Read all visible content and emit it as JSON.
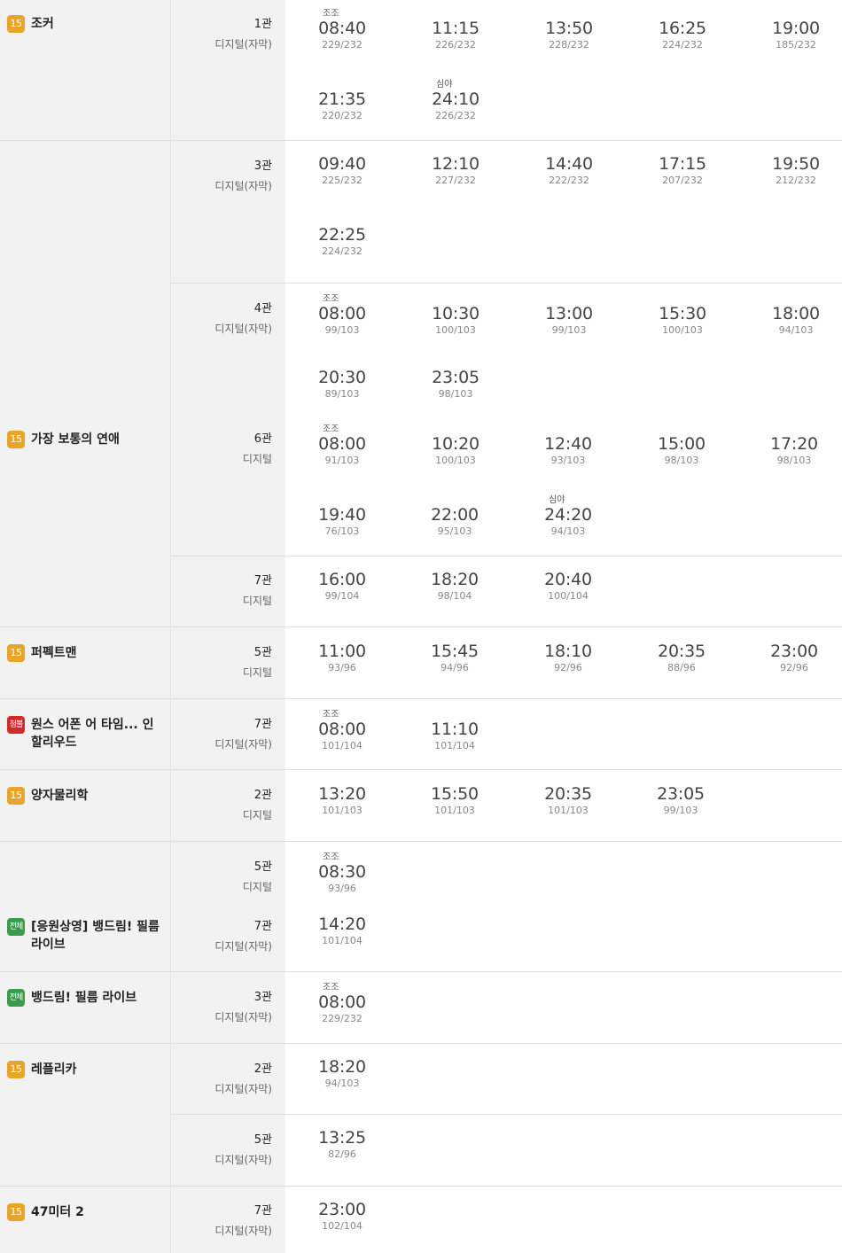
{
  "movies": [
    {
      "title": "조커",
      "rating": "15",
      "rating_class": "age15"
    },
    {
      "title": "가장 보통의 연애",
      "rating": "15",
      "rating_class": "age15"
    },
    {
      "title": "퍼펙트맨",
      "rating": "15",
      "rating_class": "age15"
    },
    {
      "title": "원스 어폰 어 타임... 인 할리우드",
      "rating": "청불",
      "rating_class": "adult"
    },
    {
      "title": "양자물리학",
      "rating": "15",
      "rating_class": "age15"
    },
    {
      "title": "[응원상영] 뱅드림! 필름 라이브",
      "rating": "전체",
      "rating_class": "all"
    },
    {
      "title": "뱅드림! 필름 라이브",
      "rating": "전체",
      "rating_class": "all"
    },
    {
      "title": "레플리카",
      "rating": "15",
      "rating_class": "age15"
    },
    {
      "title": "47미터 2",
      "rating": "15",
      "rating_class": "age15"
    }
  ],
  "halls": [
    {
      "name": "1관",
      "format": "디지털(자막)"
    },
    {
      "name": "3관",
      "format": "디지털(자막)"
    },
    {
      "name": "4관",
      "format": "디지털(자막)"
    },
    {
      "name": "6관",
      "format": "디지털"
    },
    {
      "name": "7관",
      "format": "디지털"
    },
    {
      "name": "5관",
      "format": "디지털"
    },
    {
      "name": "7관",
      "format": "디지털(자막)"
    },
    {
      "name": "2관",
      "format": "디지털"
    },
    {
      "name": "5관",
      "format": "디지털"
    },
    {
      "name": "7관",
      "format": "디지털(자막)"
    },
    {
      "name": "3관",
      "format": "디지털(자막)"
    },
    {
      "name": "2관",
      "format": "디지털(자막)"
    },
    {
      "name": "5관",
      "format": "디지털(자막)"
    },
    {
      "name": "7관",
      "format": "디지털(자막)"
    }
  ],
  "slots": [
    {
      "tag": "조조",
      "time": "08:40",
      "seats": "229/232"
    },
    {
      "tag": "",
      "time": "11:15",
      "seats": "226/232"
    },
    {
      "tag": "",
      "time": "13:50",
      "seats": "228/232"
    },
    {
      "tag": "",
      "time": "16:25",
      "seats": "224/232"
    },
    {
      "tag": "",
      "time": "19:00",
      "seats": "185/232"
    },
    {
      "tag": "",
      "time": "21:35",
      "seats": "220/232"
    },
    {
      "tag": "심야",
      "time": "24:10",
      "seats": "226/232"
    },
    {
      "tag": "",
      "time": "09:40",
      "seats": "225/232"
    },
    {
      "tag": "",
      "time": "12:10",
      "seats": "227/232"
    },
    {
      "tag": "",
      "time": "14:40",
      "seats": "222/232"
    },
    {
      "tag": "",
      "time": "17:15",
      "seats": "207/232"
    },
    {
      "tag": "",
      "time": "19:50",
      "seats": "212/232"
    },
    {
      "tag": "",
      "time": "22:25",
      "seats": "224/232"
    },
    {
      "tag": "조조",
      "time": "08:00",
      "seats": "99/103"
    },
    {
      "tag": "",
      "time": "10:30",
      "seats": "100/103"
    },
    {
      "tag": "",
      "time": "13:00",
      "seats": "99/103"
    },
    {
      "tag": "",
      "time": "15:30",
      "seats": "100/103"
    },
    {
      "tag": "",
      "time": "18:00",
      "seats": "94/103"
    },
    {
      "tag": "",
      "time": "20:30",
      "seats": "89/103"
    },
    {
      "tag": "",
      "time": "23:05",
      "seats": "98/103"
    },
    {
      "tag": "조조",
      "time": "08:00",
      "seats": "91/103"
    },
    {
      "tag": "",
      "time": "10:20",
      "seats": "100/103"
    },
    {
      "tag": "",
      "time": "12:40",
      "seats": "93/103"
    },
    {
      "tag": "",
      "time": "15:00",
      "seats": "98/103"
    },
    {
      "tag": "",
      "time": "17:20",
      "seats": "98/103"
    },
    {
      "tag": "",
      "time": "19:40",
      "seats": "76/103"
    },
    {
      "tag": "",
      "time": "22:00",
      "seats": "95/103"
    },
    {
      "tag": "심야",
      "time": "24:20",
      "seats": "94/103"
    },
    {
      "tag": "",
      "time": "16:00",
      "seats": "99/104"
    },
    {
      "tag": "",
      "time": "18:20",
      "seats": "98/104"
    },
    {
      "tag": "",
      "time": "20:40",
      "seats": "100/104"
    },
    {
      "tag": "",
      "time": "11:00",
      "seats": "93/96"
    },
    {
      "tag": "",
      "time": "15:45",
      "seats": "94/96"
    },
    {
      "tag": "",
      "time": "18:10",
      "seats": "92/96"
    },
    {
      "tag": "",
      "time": "20:35",
      "seats": "88/96"
    },
    {
      "tag": "",
      "time": "23:00",
      "seats": "92/96"
    },
    {
      "tag": "조조",
      "time": "08:00",
      "seats": "101/104"
    },
    {
      "tag": "",
      "time": "11:10",
      "seats": "101/104"
    },
    {
      "tag": "",
      "time": "13:20",
      "seats": "101/103"
    },
    {
      "tag": "",
      "time": "15:50",
      "seats": "101/103"
    },
    {
      "tag": "",
      "time": "20:35",
      "seats": "101/103"
    },
    {
      "tag": "",
      "time": "23:05",
      "seats": "99/103"
    },
    {
      "tag": "조조",
      "time": "08:30",
      "seats": "93/96"
    },
    {
      "tag": "",
      "time": "14:20",
      "seats": "101/104"
    },
    {
      "tag": "조조",
      "time": "08:00",
      "seats": "229/232"
    },
    {
      "tag": "",
      "time": "18:20",
      "seats": "94/103"
    },
    {
      "tag": "",
      "time": "13:25",
      "seats": "82/96"
    },
    {
      "tag": "",
      "time": "23:00",
      "seats": "102/104"
    }
  ]
}
